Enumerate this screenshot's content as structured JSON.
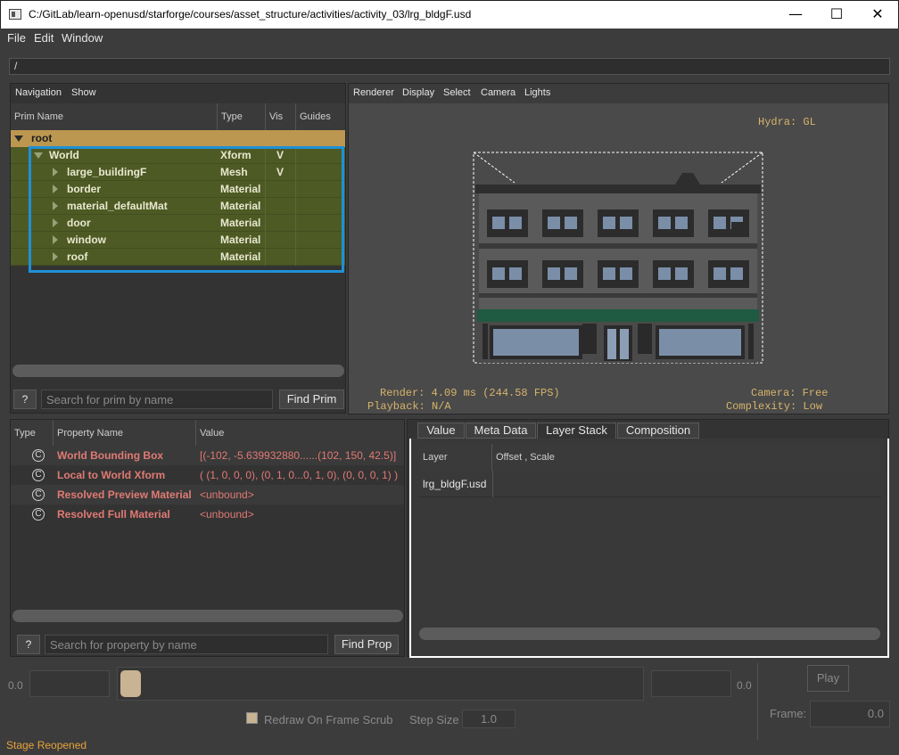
{
  "window": {
    "title": "C:/GitLab/learn-openusd/starforge/courses/asset_structure/activities/activity_03/lrg_bldgF.usd",
    "minimize": "—",
    "maximize": "☐",
    "close": "✕"
  },
  "menu": [
    "File",
    "Edit",
    "Window"
  ],
  "path": "/",
  "tree": {
    "menu": [
      "Navigation",
      "Show"
    ],
    "headers": {
      "prim_name": "Prim Name",
      "type": "Type",
      "vis": "Vis",
      "guides": "Guides"
    },
    "root": {
      "name": "root",
      "type": "",
      "vis": ""
    },
    "rows": [
      {
        "name": "World",
        "type": "Xform",
        "vis": "V"
      },
      {
        "name": "large_buildingF",
        "type": "Mesh",
        "vis": "V"
      },
      {
        "name": "border",
        "type": "Material",
        "vis": ""
      },
      {
        "name": "material_defaultMat",
        "type": "Material",
        "vis": ""
      },
      {
        "name": "door",
        "type": "Material",
        "vis": ""
      },
      {
        "name": "window",
        "type": "Material",
        "vis": ""
      },
      {
        "name": "roof",
        "type": "Material",
        "vis": ""
      }
    ],
    "help": "?",
    "search_placeholder": "Search for prim by name",
    "find_button": "Find Prim"
  },
  "viewport": {
    "menu": [
      "Renderer",
      "Display",
      "Select",
      "Camera",
      "Lights"
    ],
    "hydra": "Hydra: GL",
    "render": "Render: 4.09 ms (244.58 FPS)",
    "playback": "Playback: N/A",
    "camera": "Camera: Free",
    "complexity": "Complexity: Low"
  },
  "properties": {
    "headers": {
      "type": "Type",
      "name": "Property Name",
      "value": "Value"
    },
    "rows": [
      {
        "icon": "C",
        "name": "World Bounding Box",
        "value": "[(-102, -5.639932880......(102, 150, 42.5)]"
      },
      {
        "icon": "C",
        "name": "Local to World Xform",
        "value": "( (1, 0, 0, 0), (0, 1, 0...0, 1, 0), (0, 0, 0, 1) )"
      },
      {
        "icon": "C",
        "name": "Resolved Preview Material",
        "value": "<unbound>"
      },
      {
        "icon": "C",
        "name": "Resolved Full Material",
        "value": "<unbound>"
      }
    ],
    "help": "?",
    "search_placeholder": "Search for property by name",
    "find_button": "Find Prop"
  },
  "layer_stack": {
    "tabs": [
      "Value",
      "Meta Data",
      "Layer Stack",
      "Composition"
    ],
    "active_tab": "Layer Stack",
    "headers": {
      "layer": "Layer",
      "offset": "Offset , Scale"
    },
    "rows": [
      {
        "layer": "lrg_bldgF.usd",
        "offset": ""
      }
    ]
  },
  "timeline": {
    "start": "0.0",
    "end": "0.0",
    "redraw_label": "Redraw On Frame Scrub",
    "step_label": "Step Size",
    "step_value": "1.0",
    "play": "Play",
    "frame_label": "Frame:",
    "frame_value": "0.0"
  },
  "status": "Stage Reopened"
}
